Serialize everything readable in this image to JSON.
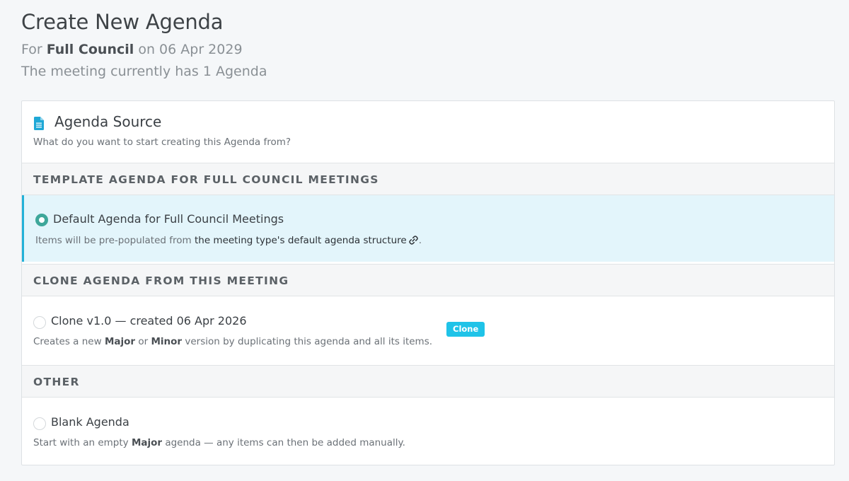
{
  "header": {
    "title": "Create New Agenda",
    "subtitle_prefix": "For",
    "meeting_type": "Full Council",
    "subtitle_mid": "on",
    "meeting_date": "06 Apr 2029",
    "agenda_count_text": "The meeting currently has 1 Agenda"
  },
  "card": {
    "icon": "document-icon",
    "title": "Agenda Source",
    "description": "What do you want to start creating this Agenda from?"
  },
  "sections": {
    "template": {
      "heading": "TEMPLATE AGENDA FOR FULL COUNCIL MEETINGS",
      "option_label": "Default Agenda for Full Council Meetings",
      "desc_prefix": "Items will be pre-populated from",
      "desc_link": "the meeting type's default agenda structure",
      "desc_suffix": ".",
      "selected": true
    },
    "clone": {
      "heading": "CLONE AGENDA FROM THIS MEETING",
      "option_label": "Clone v1.0 — created 06 Apr 2026",
      "badge": "Clone",
      "desc_prefix": "Creates a new",
      "desc_major": "Major",
      "desc_or": "or",
      "desc_minor": "Minor",
      "desc_suffix": "version by duplicating this agenda and all its items.",
      "selected": false
    },
    "other": {
      "heading": "OTHER",
      "option_label": "Blank Agenda",
      "desc_prefix": "Start with an empty",
      "desc_major": "Major",
      "desc_suffix": "agenda — any items can then be added manually.",
      "selected": false
    }
  },
  "colors": {
    "accent": "#22b1d8",
    "radio_selected": "#3ea79a",
    "badge": "#1fc3e8",
    "selected_bg": "#e3f5fb"
  }
}
